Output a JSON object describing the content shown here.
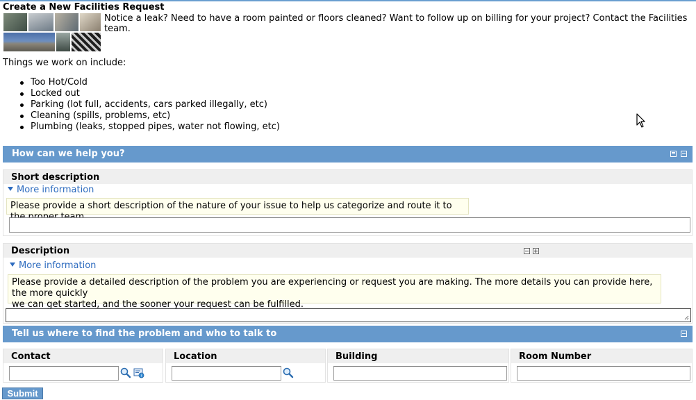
{
  "page": {
    "title": "Create a New Facilities Request",
    "intro": "Notice a leak? Need to have a room painted or floors cleaned? Want to follow up on billing for your project? Contact the Facilities team.",
    "things_heading": "Things we work on include:",
    "things": [
      "Too Hot/Cold",
      "Locked out",
      "Parking (lot full, accidents, cars parked illegally, etc)",
      "Cleaning (spills, problems, etc)",
      "Plumbing (leaks, stopped pipes, water not flowing, etc)"
    ]
  },
  "sections": {
    "help": {
      "title": "How can we help you?"
    },
    "location": {
      "title": "Tell us where to find the problem and who to talk to"
    }
  },
  "fields": {
    "short_description": {
      "label": "Short description",
      "more": "More information",
      "help": "Please provide a short description of the nature of your issue to help us categorize and route it to the proper team",
      "value": ""
    },
    "description": {
      "label": "Description",
      "more": "More information",
      "help_line1": "Please provide a detailed description of the problem you are experiencing or request you are making. The more details you can provide here, the more quickly",
      "help_line2": "we can get started, and the sooner your request can be fulfilled.",
      "value": ""
    },
    "contact": {
      "label": "Contact",
      "value": ""
    },
    "location": {
      "label": "Location",
      "value": ""
    },
    "building": {
      "label": "Building",
      "value": ""
    },
    "room_number": {
      "label": "Room Number",
      "value": ""
    }
  },
  "actions": {
    "submit": "Submit"
  },
  "icons": {
    "search": "magnifier-icon",
    "contact_card": "contact-card-icon",
    "collapse": "minus-icon",
    "expand": "plus-icon"
  },
  "colors": {
    "header_bg": "#6699cc",
    "link": "#2e6cbf",
    "help_bg": "#ffffee"
  }
}
